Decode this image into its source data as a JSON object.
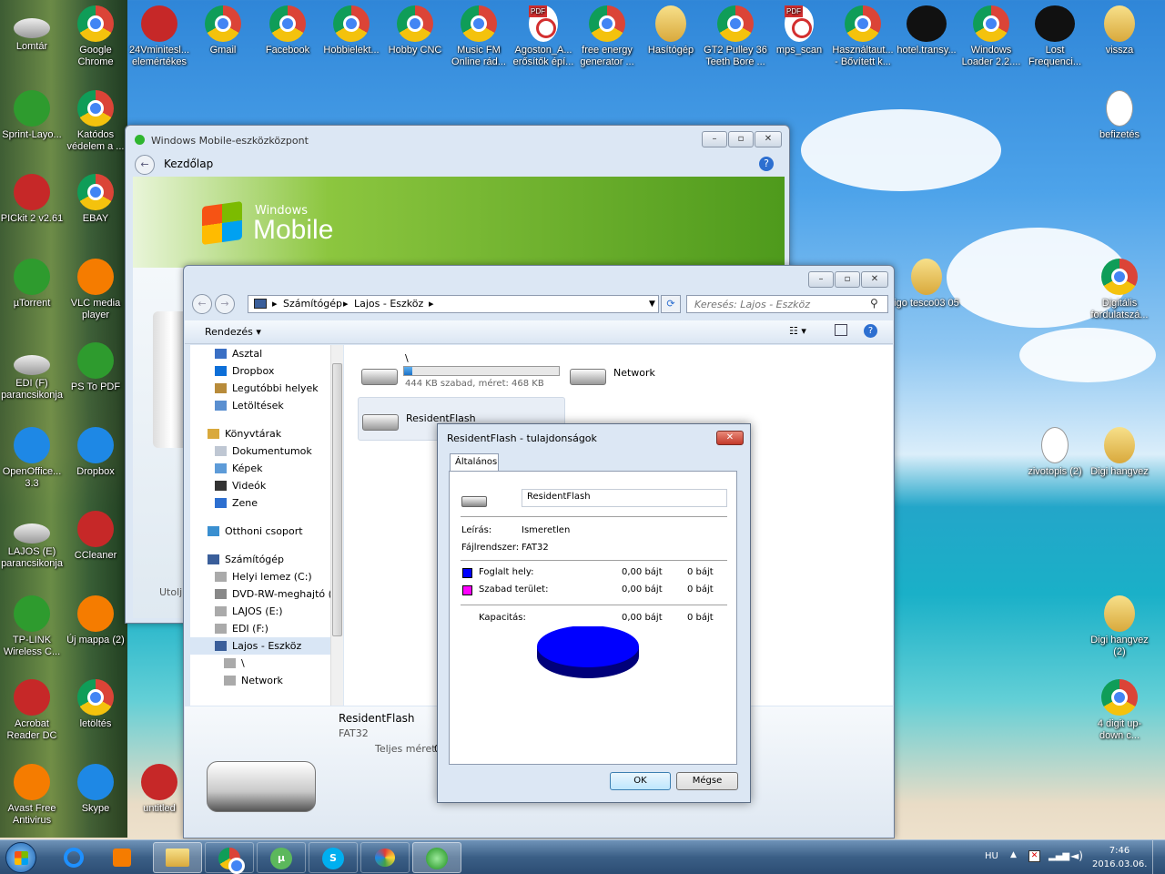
{
  "desktop": {
    "icons": [
      {
        "label": "Lomtár",
        "type": "bin"
      },
      {
        "label": "Google Chrome",
        "type": "chrome"
      },
      {
        "label": "24Vminitesl... elemértékes",
        "type": "red"
      },
      {
        "label": "Gmail",
        "type": "chrome"
      },
      {
        "label": "Facebook",
        "type": "chrome"
      },
      {
        "label": "Hobbielekt...",
        "type": "chrome"
      },
      {
        "label": "Hobby CNC",
        "type": "chrome"
      },
      {
        "label": "Music FM Online rád...",
        "type": "chrome"
      },
      {
        "label": "Agoston_A... erősítők épí...",
        "type": "pdf"
      },
      {
        "label": "free energy generator ...",
        "type": "chrome"
      },
      {
        "label": "Hasítógép",
        "type": "folder"
      },
      {
        "label": "GT2 Pulley 36 Teeth Bore ...",
        "type": "chrome"
      },
      {
        "label": "mps_scan",
        "type": "pdf"
      },
      {
        "label": "Használtaut... - Bővített k...",
        "type": "chrome"
      },
      {
        "label": "hotel.transy...",
        "type": "blk"
      },
      {
        "label": "Windows Loader 2.2....",
        "type": "chrome"
      },
      {
        "label": "Lost Frequenci...",
        "type": "blk"
      },
      {
        "label": "vissza",
        "type": "folder"
      },
      {
        "label": "Sprint-Layo...",
        "type": "grn"
      },
      {
        "label": "Katódos védelem a ...",
        "type": "chrome"
      },
      {
        "label": "befizetés",
        "type": "doc"
      },
      {
        "label": "PICkit 2 v2.61",
        "type": "red"
      },
      {
        "label": "EBAY",
        "type": "chrome"
      },
      {
        "label": "igo tesco03 05",
        "type": "folder"
      },
      {
        "label": "Digitális fordulatszá...",
        "type": "chrome"
      },
      {
        "label": "µTorrent",
        "type": "grn"
      },
      {
        "label": "VLC media player",
        "type": "org"
      },
      {
        "label": "EDI (F) parancsikonja",
        "type": "drv"
      },
      {
        "label": "PS To PDF",
        "type": "grn"
      },
      {
        "label": "zivotopis (2)",
        "type": "doc"
      },
      {
        "label": "Digi hangvez",
        "type": "folder"
      },
      {
        "label": "OpenOffice... 3.3",
        "type": "blu"
      },
      {
        "label": "Dropbox",
        "type": "blu"
      },
      {
        "label": "LAJOS (E) parancsikonja",
        "type": "drv"
      },
      {
        "label": "CCleaner",
        "type": "red"
      },
      {
        "label": "TP-LINK Wireless C...",
        "type": "grn"
      },
      {
        "label": "Új mappa (2)",
        "type": "org"
      },
      {
        "label": "Digi hangvez (2)",
        "type": "folder"
      },
      {
        "label": "Acrobat Reader DC",
        "type": "red"
      },
      {
        "label": "letöltés",
        "type": "chrome"
      },
      {
        "label": "4 digit up-down c...",
        "type": "chrome"
      },
      {
        "label": "Avast Free Antivirus",
        "type": "org"
      },
      {
        "label": "Skype",
        "type": "blu"
      },
      {
        "label": "untitled",
        "type": "red"
      }
    ]
  },
  "wmdc": {
    "title": "Windows Mobile-eszközközpont",
    "home": "Kezdőlap",
    "logo_small": "Windows",
    "logo_big": "Mobile",
    "partial_text": "Utolj"
  },
  "explorer": {
    "breadcrumb": [
      "Számítógép",
      "Lajos - Eszköz"
    ],
    "search_placeholder": "Keresés: Lajos - Eszköz",
    "organize": "Rendezés",
    "nav": [
      {
        "label": "Asztal",
        "icon": "desktop-icon",
        "group": "fav"
      },
      {
        "label": "Dropbox",
        "icon": "dropbox-icon",
        "group": "fav"
      },
      {
        "label": "Legutóbbi helyek",
        "icon": "recent-icon",
        "group": "fav"
      },
      {
        "label": "Letöltések",
        "icon": "download-icon",
        "group": "fav"
      },
      {
        "label": "Könyvtárak",
        "icon": "library-icon",
        "group": "lib"
      },
      {
        "label": "Dokumentumok",
        "icon": "documents-icon",
        "group": "lib"
      },
      {
        "label": "Képek",
        "icon": "pictures-icon",
        "group": "lib"
      },
      {
        "label": "Videók",
        "icon": "videos-icon",
        "group": "lib"
      },
      {
        "label": "Zene",
        "icon": "music-icon",
        "group": "lib"
      },
      {
        "label": "Otthoni csoport",
        "icon": "homegroup-icon",
        "group": "home"
      },
      {
        "label": "Számítógép",
        "icon": "computer-icon",
        "group": "pc"
      },
      {
        "label": "Helyi lemez (C:)",
        "icon": "drive-icon",
        "group": "pc"
      },
      {
        "label": "DVD-RW-meghajtó (D",
        "icon": "dvd-icon",
        "group": "pc"
      },
      {
        "label": "LAJOS (E:)",
        "icon": "drive-icon",
        "group": "pc"
      },
      {
        "label": "EDI (F:)",
        "icon": "drive-icon",
        "group": "pc"
      },
      {
        "label": "Lajos - Eszköz",
        "icon": "device-icon",
        "group": "pc"
      },
      {
        "label": "\\",
        "icon": "drive-icon",
        "group": "pc"
      },
      {
        "label": "Network",
        "icon": "drive-icon",
        "group": "pc"
      }
    ],
    "items": [
      {
        "name": "\\",
        "info": "444 KB szabad, méret: 468 KB",
        "usage": 0.05
      },
      {
        "name": "Network",
        "info": ""
      },
      {
        "name": "ResidentFlash",
        "info": ""
      }
    ],
    "details": {
      "name": "ResidentFlash",
      "fs": "FAT32",
      "total_label": "Teljes méret:",
      "total_value": "0"
    }
  },
  "props": {
    "title": "ResidentFlash - tulajdonságok",
    "tab": "Általános",
    "name_value": "ResidentFlash",
    "desc_label": "Leírás:",
    "desc_value": "Ismeretlen",
    "fs_label": "Fájlrendszer:",
    "fs_value": "FAT32",
    "used_label": "Foglalt hely:",
    "used_bytes": "0,00 bájt",
    "used_size": "0 bájt",
    "used_color": "#0000ff",
    "free_label": "Szabad terület:",
    "free_bytes": "0,00 bájt",
    "free_size": "0 bájt",
    "free_color": "#ff00ff",
    "cap_label": "Kapacitás:",
    "cap_bytes": "0,00 bájt",
    "cap_size": "0 bájt",
    "ok": "OK",
    "cancel": "Mégse"
  },
  "taskbar": {
    "lang": "HU",
    "time": "7:46",
    "date": "2016.03.06."
  }
}
